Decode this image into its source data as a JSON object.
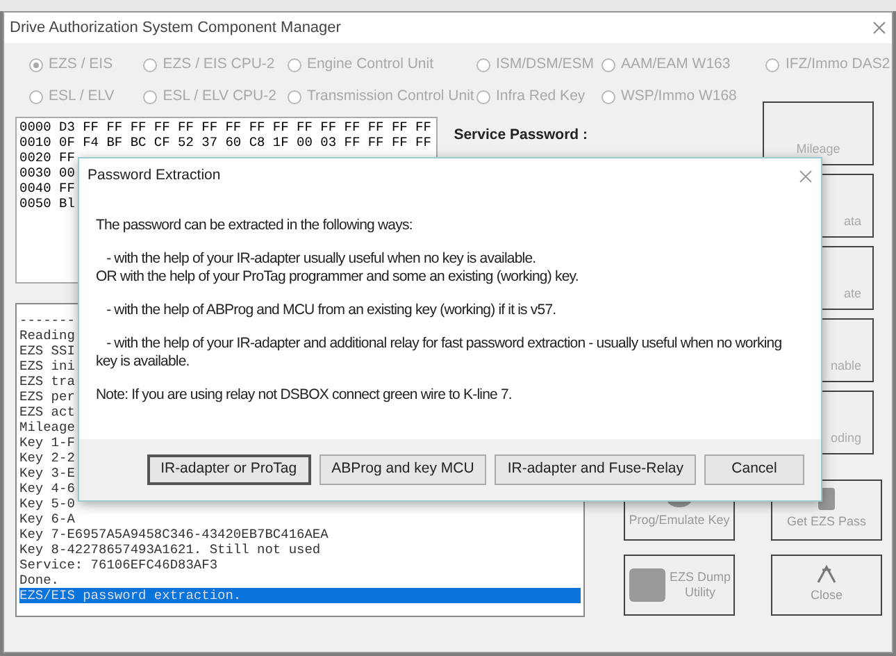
{
  "window": {
    "title": "Drive Authorization System Component Manager"
  },
  "modules": [
    {
      "label": "EZS / EIS",
      "selected": true,
      "disabled": true
    },
    {
      "label": "EZS / EIS CPU-2",
      "selected": false,
      "disabled": true
    },
    {
      "label": "Engine Control Unit",
      "selected": false,
      "disabled": true
    },
    {
      "label": "ISM/DSM/ESM",
      "selected": false,
      "disabled": true
    },
    {
      "label": "AAM/EAM W163",
      "selected": false,
      "disabled": true
    },
    {
      "label": "IFZ/Immo DAS2",
      "selected": false,
      "disabled": true
    },
    {
      "label": "ESL / ELV",
      "selected": false,
      "disabled": true
    },
    {
      "label": "ESL / ELV CPU-2",
      "selected": false,
      "disabled": true
    },
    {
      "label": "Transmission Control Unit",
      "selected": false,
      "disabled": true
    },
    {
      "label": "Infra Red Key",
      "selected": false,
      "disabled": true
    },
    {
      "label": "WSP/Immo W168",
      "selected": false,
      "disabled": true
    }
  ],
  "hex_dump": [
    "0000 D3 FF FF FF FF FF FF FF FF FF FF FF FF FF FF FF",
    "0010 0F F4 BF BC CF 52 37 60 C8 1F 00 03 FF FF FF FF",
    "0020 FF",
    "0030 00",
    "0040 FF",
    "0050 Bl"
  ],
  "service_password": {
    "label": "Service Password :"
  },
  "log": [
    {
      "text": "-------",
      "selected": false
    },
    {
      "text": "Reading",
      "selected": false
    },
    {
      "text": "EZS SSI",
      "selected": false
    },
    {
      "text": "EZS ini",
      "selected": false
    },
    {
      "text": "EZS tra",
      "selected": false
    },
    {
      "text": "EZS per",
      "selected": false
    },
    {
      "text": "EZS act",
      "selected": false
    },
    {
      "text": "Mileage",
      "selected": false
    },
    {
      "text": "Key 1-F",
      "selected": false
    },
    {
      "text": "Key 2-2",
      "selected": false
    },
    {
      "text": "Key 3-E",
      "selected": false
    },
    {
      "text": "Key 4-6",
      "selected": false
    },
    {
      "text": "Key 5-0",
      "selected": false
    },
    {
      "text": "Key 6-A",
      "selected": false
    },
    {
      "text": "Key 7-E6957A5A9458C346-43420EB7BC416AEA",
      "selected": false
    },
    {
      "text": "Key 8-42278657493A1621. Still not used",
      "selected": false
    },
    {
      "text": "Service: 76106EFC46D83AF3",
      "selected": false
    },
    {
      "text": "Done.",
      "selected": false
    },
    {
      "text": "EZS/EIS password extraction.",
      "selected": true
    }
  ],
  "side_buttons": [
    {
      "label": "Mileage"
    },
    {
      "label": "ata"
    },
    {
      "label": "ate"
    },
    {
      "label": "nable"
    },
    {
      "label": "oding"
    }
  ],
  "bottom_buttons": [
    {
      "label": "Prog/Emulate Key",
      "kind": "key"
    },
    {
      "label": "Get EZS Pass",
      "kind": "pass"
    },
    {
      "label": "EZS Dump Utility",
      "kind": "chip"
    },
    {
      "label": "Close",
      "kind": "close"
    }
  ],
  "dialog": {
    "title": "Password Extraction",
    "intro": "The password can be extracted in the following ways:",
    "options": [
      [
        "   - with the help of your IR-adapter usually useful when no key is available.",
        "OR with the help of your ProTag programmer and some an existing (working) key."
      ],
      [
        "   - with the help of ABProg and MCU from an existing key (working) if it is v57."
      ],
      [
        "   - with the help of your IR-adapter and additional relay for fast password extraction - usually useful when no working key is available."
      ]
    ],
    "note": "Note: If you are using relay not DSBOX connect green wire to K-line 7.",
    "buttons": [
      {
        "label": "IR-adapter or ProTag",
        "selected": true
      },
      {
        "label": "ABProg and key MCU",
        "selected": false
      },
      {
        "label": "IR-adapter and Fuse-Relay",
        "selected": false
      },
      {
        "label": "Cancel",
        "selected": false
      }
    ]
  }
}
